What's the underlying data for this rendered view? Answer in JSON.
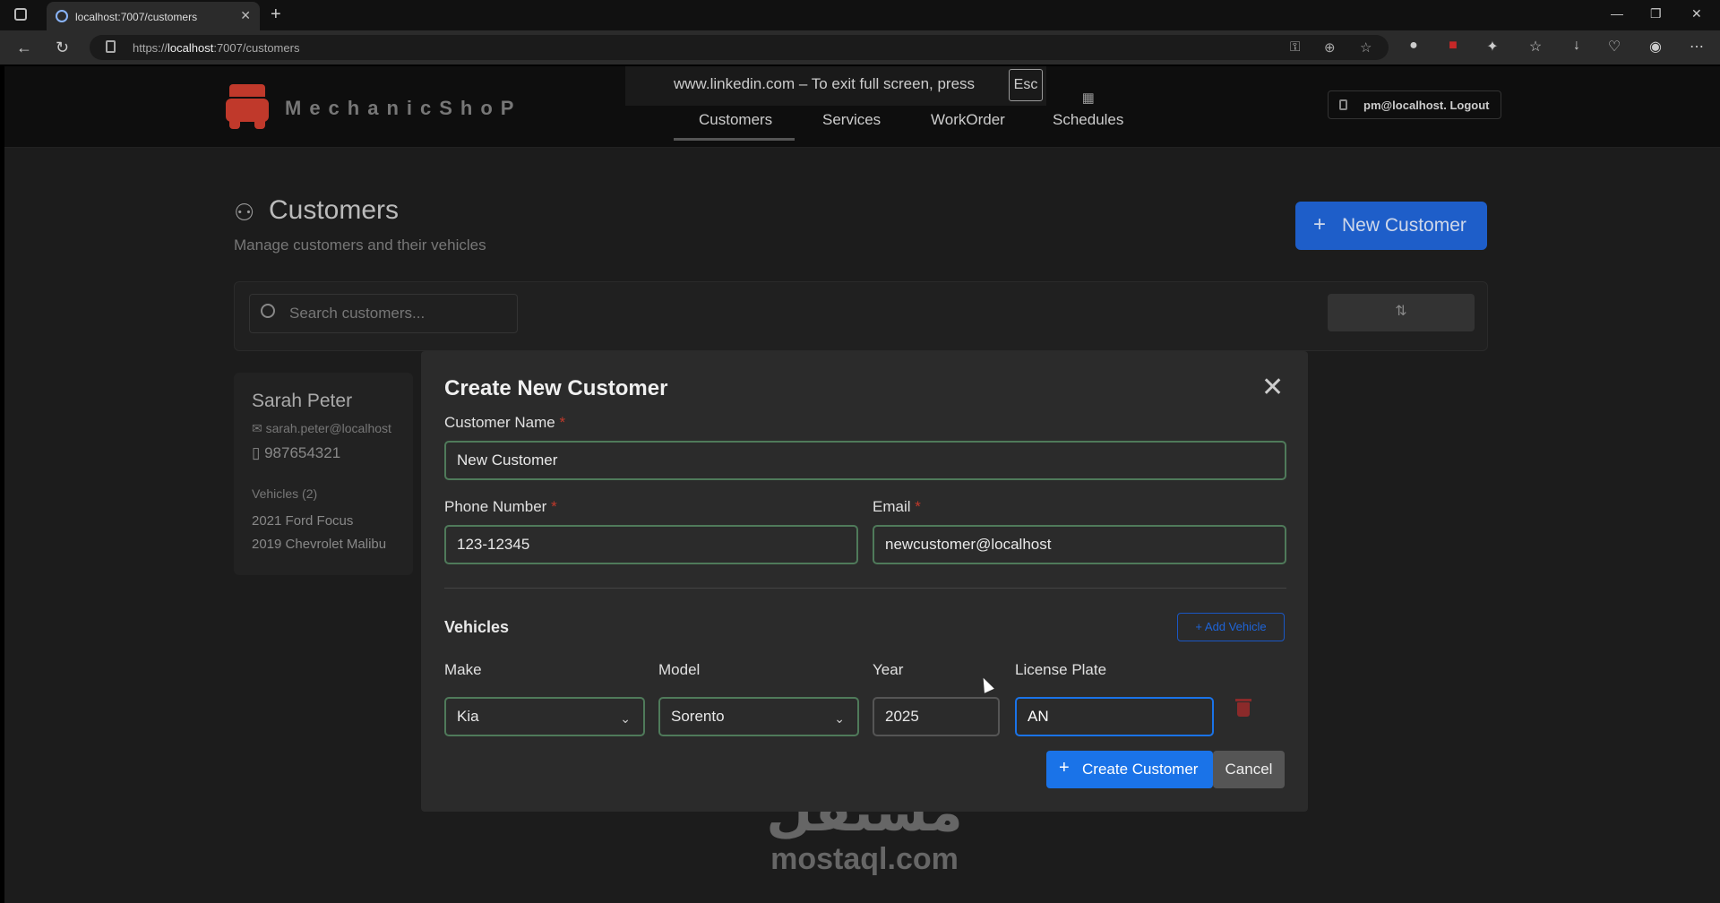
{
  "browser": {
    "tab_title": "localhost:7007/customers",
    "url_prefix": "https://",
    "url_host": "localhost",
    "url_path": ":7007/customers"
  },
  "fullscreen_toast": {
    "text": "www.linkedin.com – To exit full screen, press",
    "key": "Esc"
  },
  "app": {
    "brand": "MechanicShoP",
    "nav": [
      {
        "label": "Customers",
        "icon": "users-icon"
      },
      {
        "label": "Services",
        "icon": "tools-icon"
      },
      {
        "label": "WorkOrder",
        "icon": "clock-icon"
      },
      {
        "label": "Schedules",
        "icon": "calendar-icon"
      }
    ],
    "user": "pm@localhost. Logout"
  },
  "page": {
    "title": "Customers",
    "subtitle": "Manage customers and their vehicles",
    "new_button": "New Customer",
    "search_placeholder": "Search customers..."
  },
  "customer_card": {
    "name": "Sarah Peter",
    "email": "sarah.peter@localhost",
    "phone": "987654321",
    "vehicles_heading": "Vehicles (2)",
    "vehicles": [
      "2021 Ford Focus",
      "2019 Chevrolet Malibu"
    ]
  },
  "modal": {
    "title": "Create New Customer",
    "name_label": "Customer Name",
    "name_value": "New Customer",
    "phone_label": "Phone Number",
    "phone_value": "123-12345",
    "email_label": "Email",
    "email_value": "newcustomer@localhost",
    "required_mark": "*",
    "vehicles_title": "Vehicles",
    "add_vehicle": "+ Add Vehicle",
    "make_label": "Make",
    "make_value": "Kia",
    "model_label": "Model",
    "model_value": "Sorento",
    "year_label": "Year",
    "year_value": "2025",
    "plate_label": "License Plate",
    "plate_value": "AN",
    "create_button": "Create Customer",
    "cancel_button": "Cancel"
  },
  "watermark": {
    "arabic": "مستقل",
    "latin": "mostaql.com"
  },
  "colors": {
    "primary": "#1a73e8",
    "danger": "#c0392b",
    "input_border": "#4f7a5a"
  }
}
